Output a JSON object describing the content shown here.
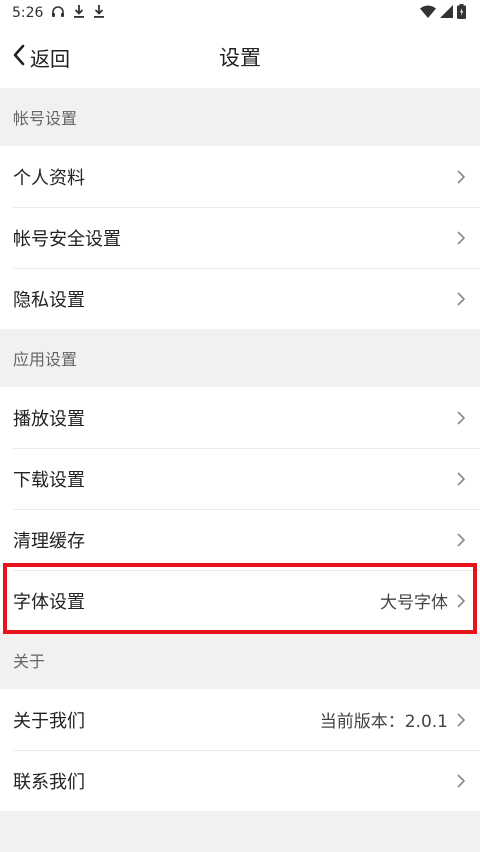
{
  "status": {
    "time": "5:26"
  },
  "nav": {
    "back_label": "返回",
    "title": "设置"
  },
  "sections": [
    {
      "header": "帐号设置",
      "items": [
        {
          "label": "个人资料",
          "value": ""
        },
        {
          "label": "帐号安全设置",
          "value": ""
        },
        {
          "label": "隐私设置",
          "value": ""
        }
      ]
    },
    {
      "header": "应用设置",
      "items": [
        {
          "label": "播放设置",
          "value": ""
        },
        {
          "label": "下载设置",
          "value": ""
        },
        {
          "label": "清理缓存",
          "value": ""
        },
        {
          "label": "字体设置",
          "value": "大号字体"
        }
      ]
    },
    {
      "header": "关于",
      "items": [
        {
          "label": "关于我们",
          "value": "当前版本：2.0.1"
        },
        {
          "label": "联系我们",
          "value": ""
        }
      ]
    }
  ],
  "colors": {
    "highlight": "#e8141c",
    "background": "#f2f1f0"
  }
}
